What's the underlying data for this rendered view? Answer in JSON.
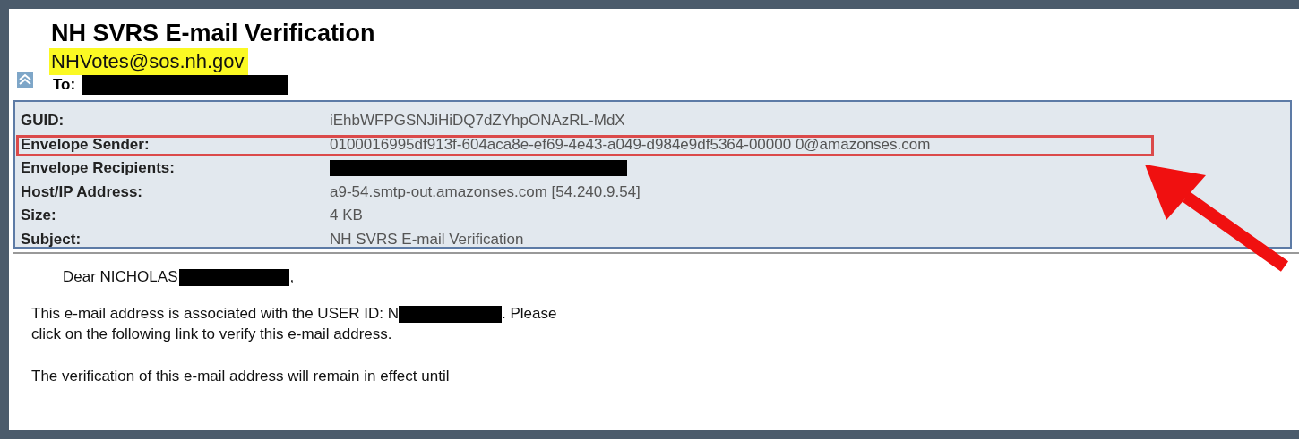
{
  "message": {
    "subject": "NH SVRS E-mail Verification",
    "sender": "NHVotes@sos.nh.gov",
    "sender_highlighted": true,
    "to_label": "To:",
    "to_redacted": true
  },
  "details": [
    {
      "label": "GUID:",
      "value": "iEhbWFPGSNJiHiDQ7dZYhpONAzRL-MdX",
      "annotated": false
    },
    {
      "label": "Envelope Sender:",
      "value": "0100016995df913f-604aca8e-ef69-4e43-a049-d984e9df5364-00000 0@amazonses.com",
      "annotated": true
    },
    {
      "label": "Envelope Recipients:",
      "redacted": true,
      "annotated": false
    },
    {
      "label": "Host/IP Address:",
      "value": "a9-54.smtp-out.amazonses.com [54.240.9.54]",
      "annotated": false
    },
    {
      "label": "Size:",
      "value": "4 KB",
      "annotated": false
    },
    {
      "label": "Subject:",
      "value": "NH SVRS E-mail Verification",
      "annotated": false
    }
  ],
  "body": [
    {
      "kind": "salutation",
      "segments": [
        {
          "kind": "text",
          "text": "Dear NICHOLAS"
        },
        {
          "kind": "redacted"
        },
        {
          "kind": "text",
          "text": ","
        }
      ]
    },
    {
      "kind": "paragraph",
      "segments": [
        {
          "kind": "text",
          "text": "This e-mail address is associated with the USER ID: N"
        },
        {
          "kind": "redacted"
        },
        {
          "kind": "text",
          "text": ". Please"
        },
        {
          "kind": "break"
        },
        {
          "kind": "text",
          "text": "click on the following link to verify this e-mail address."
        }
      ]
    },
    {
      "kind": "paragraph",
      "segments": [
        {
          "kind": "text",
          "text": "The verification of this e-mail address will remain in effect until"
        }
      ]
    }
  ]
}
